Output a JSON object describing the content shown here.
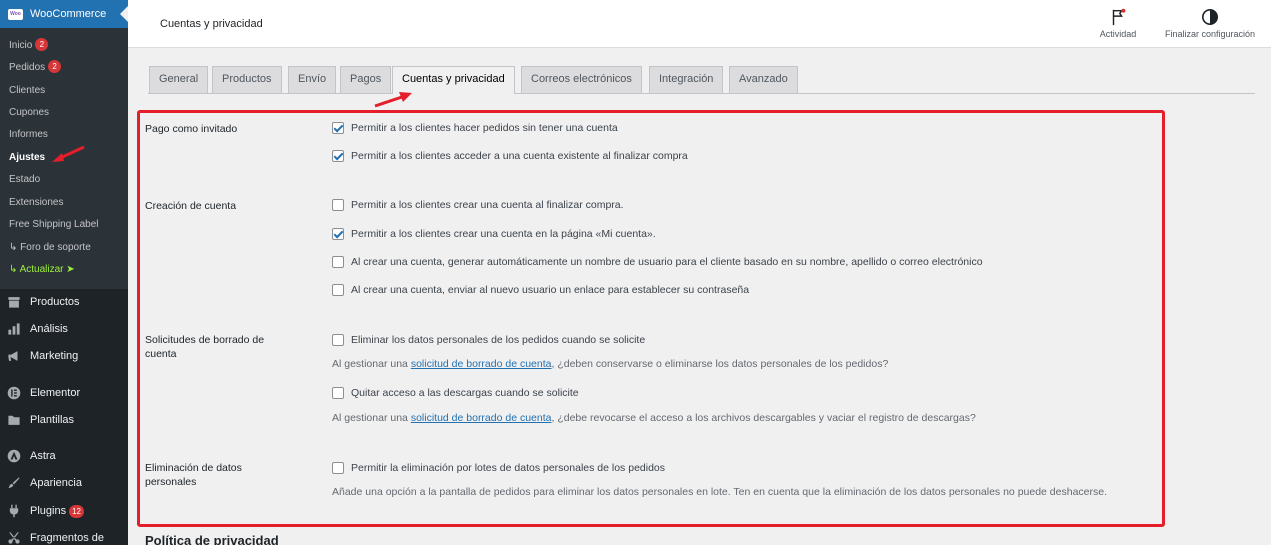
{
  "sidebar": {
    "woo_title": "WooCommerce",
    "woo_logo": "Woo",
    "submenu": [
      {
        "label": "Inicio",
        "badge": "2"
      },
      {
        "label": "Pedidos",
        "badge": "2"
      },
      {
        "label": "Clientes"
      },
      {
        "label": "Cupones"
      },
      {
        "label": "Informes"
      },
      {
        "label": "Ajustes"
      },
      {
        "label": "Estado"
      },
      {
        "label": "Extensiones"
      },
      {
        "label": "Free Shipping Label"
      },
      {
        "label": "↳ Foro de soporte"
      },
      {
        "label": "↳ Actualizar ➤"
      }
    ],
    "menu": [
      {
        "label": "Productos",
        "icon": "archive-icon"
      },
      {
        "label": "Análisis",
        "icon": "chart-bar-icon"
      },
      {
        "label": "Marketing",
        "icon": "megaphone-icon"
      },
      {
        "label": "Elementor",
        "icon": "elementor-icon"
      },
      {
        "label": "Plantillas",
        "icon": "folder-icon"
      },
      {
        "label": "Astra",
        "icon": "astra-icon"
      },
      {
        "label": "Apariencia",
        "icon": "paintbrush-icon"
      },
      {
        "label": "Plugins",
        "icon": "plug-icon",
        "badge": "12"
      },
      {
        "label": "Fragmentos de",
        "icon": "scissors-icon"
      }
    ]
  },
  "header": {
    "title": "Cuentas y privacidad",
    "activity_label": "Actividad",
    "finish_label": "Finalizar configuración"
  },
  "tabs": [
    {
      "label": "General"
    },
    {
      "label": "Productos"
    },
    {
      "label": "Envío"
    },
    {
      "label": "Pagos"
    },
    {
      "label": "Cuentas y privacidad",
      "active": true
    },
    {
      "label": "Correos electrónicos"
    },
    {
      "label": "Integración"
    },
    {
      "label": "Avanzado"
    }
  ],
  "settings": {
    "guest": {
      "label": "Pago como invitado",
      "options": [
        {
          "text": "Permitir a los clientes hacer pedidos sin tener una cuenta",
          "checked": true
        },
        {
          "text": "Permitir a los clientes acceder a una cuenta existente al finalizar compra",
          "checked": true
        }
      ]
    },
    "account": {
      "label": "Creación de cuenta",
      "options": [
        {
          "text": "Permitir a los clientes crear una cuenta al finalizar compra.",
          "checked": false
        },
        {
          "text": "Permitir a los clientes crear una cuenta en la página «Mi cuenta».",
          "checked": true
        },
        {
          "text": "Al crear una cuenta, generar automáticamente un nombre de usuario para el cliente basado en su nombre, apellido o correo electrónico",
          "checked": false
        },
        {
          "text": "Al crear una cuenta, enviar al nuevo usuario un enlace para establecer su contraseña",
          "checked": false
        }
      ]
    },
    "erasure": {
      "label_line1": "Solicitudes de borrado de",
      "label_line2": "cuenta",
      "opt1": {
        "text": "Eliminar los datos personales de los pedidos cuando se solicite",
        "checked": false
      },
      "desc1_pre": "Al gestionar una ",
      "desc1_link": "solicitud de borrado de cuenta",
      "desc1_post": ", ¿deben conservarse o eliminarse los datos personales de los pedidos?",
      "opt2": {
        "text": "Quitar acceso a las descargas cuando se solicite",
        "checked": false
      },
      "desc2_pre": "Al gestionar una ",
      "desc2_link": "solicitud de borrado de cuenta",
      "desc2_post": ", ¿debe revocarse el acceso a los archivos descargables y vaciar el registro de descargas?"
    },
    "removal": {
      "label_line1": "Eliminación de datos",
      "label_line2": "personales",
      "opt": {
        "text": "Permitir la eliminación por lotes de datos personales de los pedidos",
        "checked": false
      },
      "desc": "Añade una opción a la pantalla de pedidos para eliminar los datos personales en lote. Ten en cuenta que la eliminación de los datos personales no puede deshacerse."
    }
  },
  "next_section": "Política de privacidad",
  "colors": {
    "highlight": "#e41e2a",
    "accent": "#2271b1",
    "badge": "#d63638"
  }
}
